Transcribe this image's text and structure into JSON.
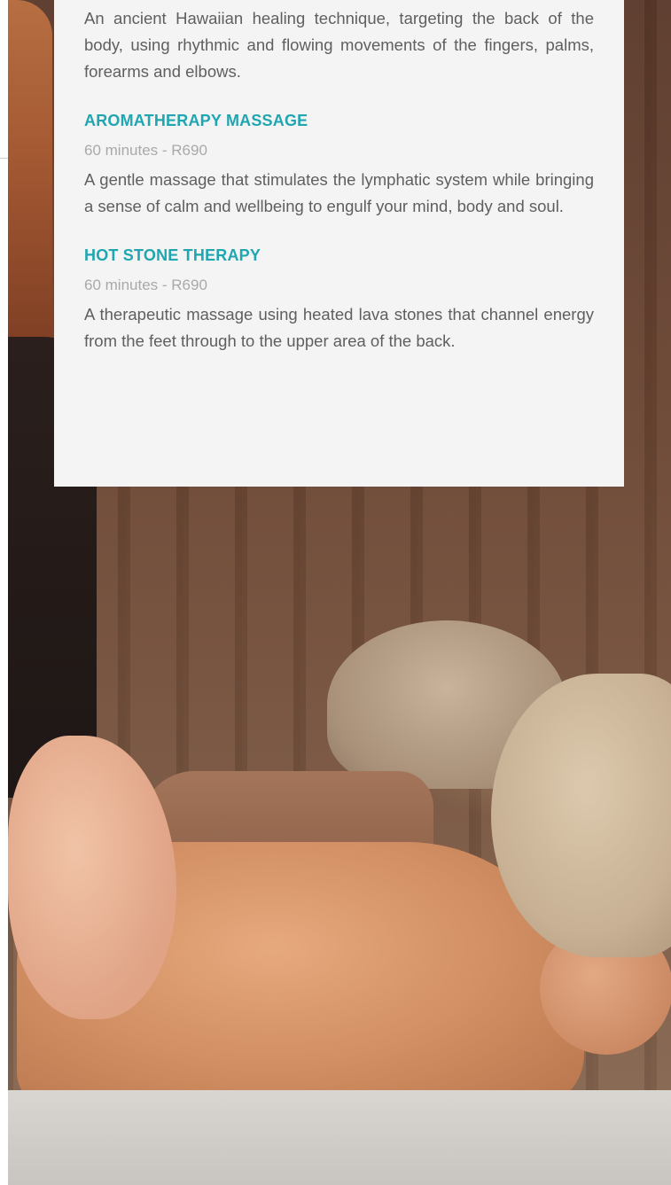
{
  "intro": {
    "description": "An ancient Hawaiian healing technique, targeting the back of the body, using rhythmic and flowing movements of the fingers, palms, forearms and elbows."
  },
  "services": [
    {
      "title": "AROMATHERAPY MASSAGE",
      "meta": "60 minutes - R690",
      "description": "A gentle massage that stimulates the lymphatic system while bringing a sense of calm and wellbeing to engulf your mind, body and soul."
    },
    {
      "title": "HOT STONE THERAPY",
      "meta": "60 minutes - R690",
      "description": "A therapeutic massage using heated lava stones that channel energy from the feet through to the upper area of the back."
    }
  ],
  "colors": {
    "accent": "#1fa6b0",
    "card_background": "#f4f4f4",
    "body_text": "#5f5f5f",
    "meta_text": "#a9a9a9"
  }
}
